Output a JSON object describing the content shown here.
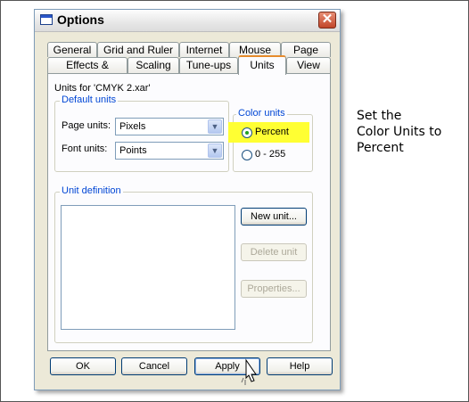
{
  "window": {
    "title": "Options",
    "close_glyph": "✕"
  },
  "tabs": {
    "row_top": [
      "General",
      "Grid and Ruler",
      "Internet",
      "Mouse",
      "Page"
    ],
    "row_bottom": [
      "Effects & Plugins",
      "Scaling",
      "Tune-ups",
      "Units",
      "View"
    ],
    "selected": "Units"
  },
  "panel": {
    "units_for": "Units for 'CMYK 2.xar'",
    "default_units": {
      "legend": "Default units",
      "page_units_label": "Page units:",
      "page_units_value": "Pixels",
      "font_units_label": "Font units:",
      "font_units_value": "Points"
    },
    "color_units": {
      "legend": "Color units",
      "options": [
        "Percent",
        "0 - 255"
      ],
      "selected": "Percent",
      "highlight_color": "#ffff33"
    },
    "unit_definition": {
      "legend": "Unit definition",
      "new_unit_label": "New unit...",
      "delete_unit_label": "Delete unit",
      "properties_label": "Properties..."
    }
  },
  "buttons": {
    "ok": "OK",
    "cancel": "Cancel",
    "apply": "Apply",
    "help": "Help"
  },
  "instruction": {
    "lines": [
      "Set the",
      "Color Units to",
      "Percent"
    ]
  },
  "icons": {
    "dropdown": "chevron-down-icon",
    "close": "close-icon",
    "cursor": "mouse-pointer-icon"
  }
}
